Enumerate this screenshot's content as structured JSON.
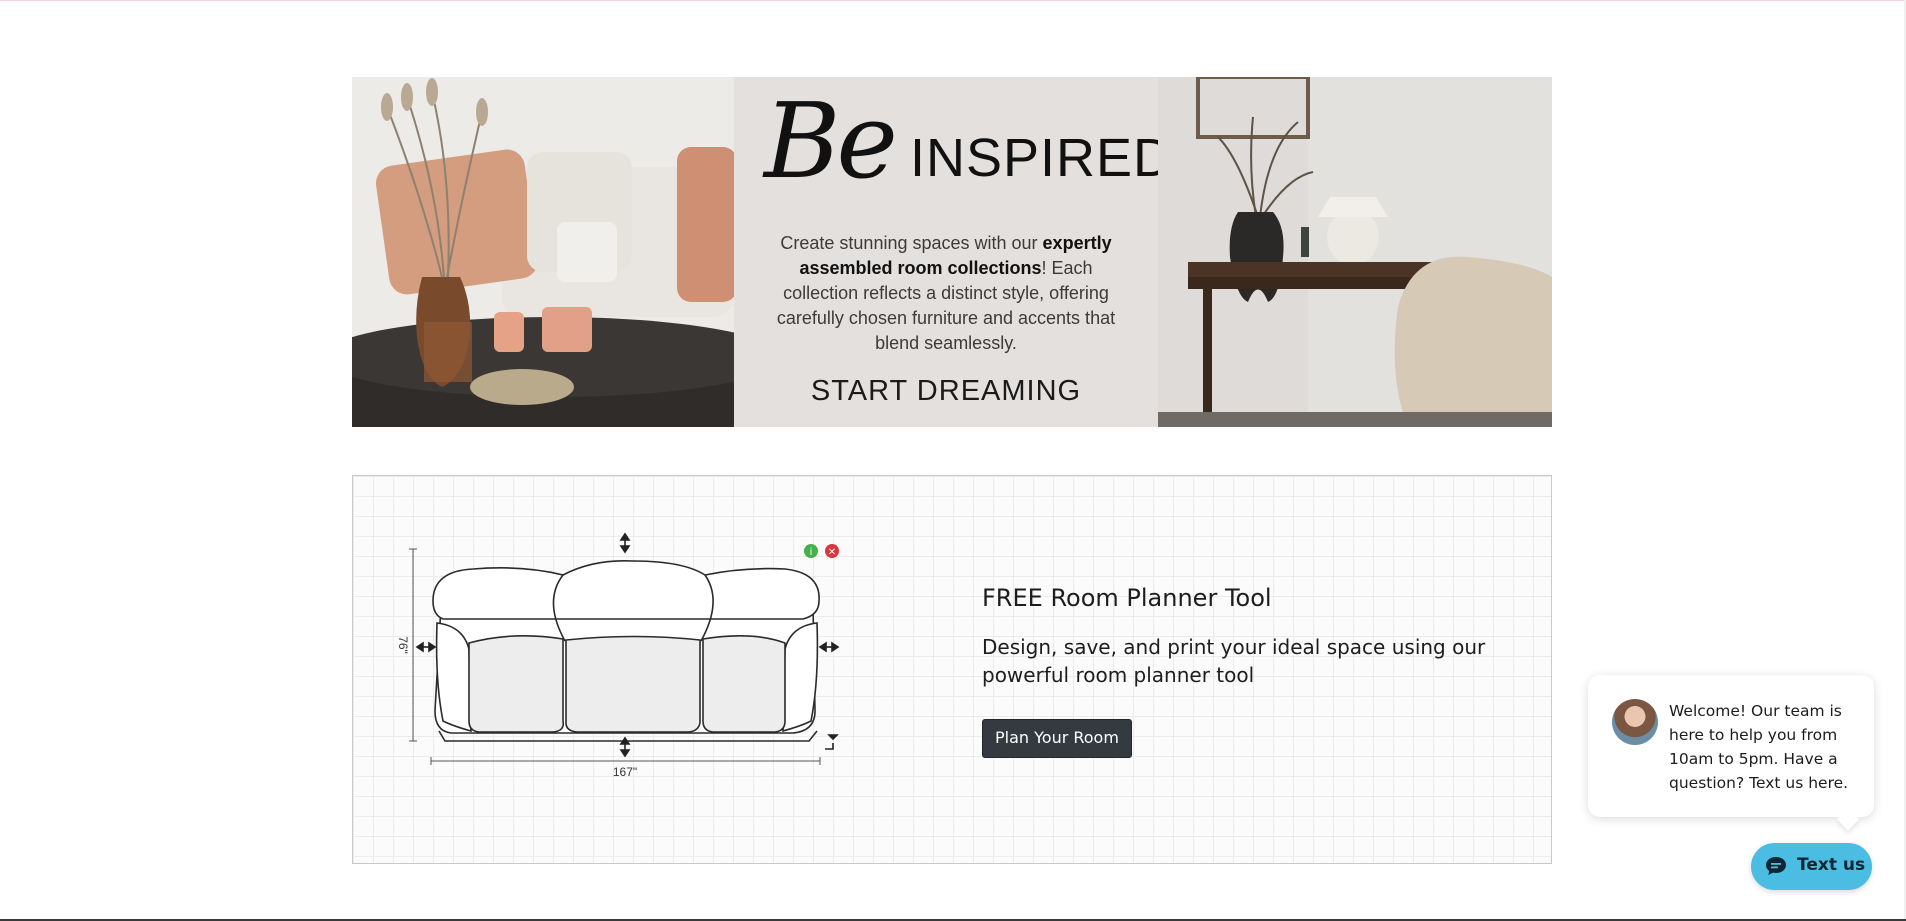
{
  "banner": {
    "heading_script": "Be",
    "heading_caps": "INSPIRED",
    "body_before": "Create stunning spaces with our ",
    "body_bold": "expertly assembled room collections",
    "body_after": "! Each collection reflects a distinct style, offering carefully chosen furniture and accents that blend seamlessly.",
    "cta": "START DREAMING"
  },
  "planner": {
    "title": "FREE Room Planner Tool",
    "description": "Design, save, and print your ideal space using our powerful room planner tool",
    "button_label": "Plan Your Room",
    "sofa": {
      "height_label": "76\"",
      "width_label": "167\"",
      "info_icon": "info-icon",
      "remove_icon": "remove-icon"
    },
    "colors": {
      "button_bg": "#343a40",
      "info": "#47b04b",
      "remove": "#d9363e"
    }
  },
  "chat": {
    "welcome": "Welcome! Our team is here to help you from 10am to 5pm. Have a question? Text us here.",
    "button_label": "Text us",
    "icon": "chat-icon",
    "accent": "#4bbde2"
  }
}
